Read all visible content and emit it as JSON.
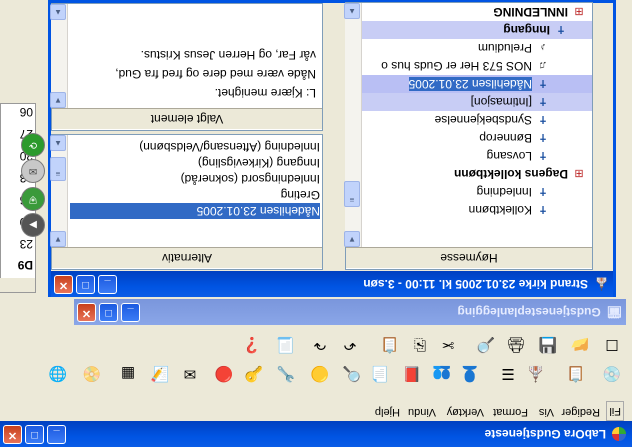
{
  "app": {
    "title": "LabOra Gudstjeneste",
    "menu": [
      "Fil",
      "Rediger",
      "Vis",
      "Format",
      "Verktøy",
      "Vindu",
      "Hjelp"
    ]
  },
  "planner_window": {
    "title": "Gudstjenesteplanlegging"
  },
  "service_window": {
    "title": "Strand kirke 23.01.2005 kl. 11:00 - 3.søn",
    "order_panel": {
      "header": "Høymesse",
      "items": [
        {
          "label": "INNLEDNING",
          "icon": "group-icon",
          "selected": false
        },
        {
          "label": "Inngang",
          "icon": "cross-icon",
          "selected": false
        },
        {
          "label": "Preludium",
          "icon": "music-icon",
          "selected": false
        },
        {
          "label": "NOS 573 Her er Guds hus o",
          "icon": "hymn-icon",
          "selected": false
        },
        {
          "label": "Nådehilsen 23.01.2005",
          "icon": "cross-icon",
          "selected": true
        },
        {
          "label": "[Intimasjon]",
          "icon": "cross-icon",
          "selected": false
        },
        {
          "label": "Syndsbekjennelse",
          "icon": "cross-icon",
          "selected": false
        },
        {
          "label": "Bønnerop",
          "icon": "cross-icon",
          "selected": false
        },
        {
          "label": "Lovsang",
          "icon": "cross-icon",
          "selected": false
        },
        {
          "label": "Dagens kollektbønn",
          "icon": "group-icon",
          "selected": false
        },
        {
          "label": "Innledning",
          "icon": "cross-icon",
          "selected": false
        },
        {
          "label": "Kollektbønn",
          "icon": "cross-icon",
          "selected": false
        }
      ]
    },
    "alternatives_panel": {
      "header": "Alternativ",
      "items": [
        "Innledning (Aftensang/Veldsbønn)",
        "Inngang (Kirkevigsling)",
        "Innledningsord (sokneråd)",
        "Greting",
        "Nådehilsen 23.01.2005"
      ],
      "selected_index": 4
    },
    "selected_panel": {
      "header": "Valgt element",
      "lines": [
        "L: Kjære menighet.",
        "Nåde være med dere og fred fra Gud,",
        "vår Far, og Herren Jesus Kristus."
      ]
    }
  },
  "background_table": {
    "rows": [
      "23",
      "30",
      "06",
      "13",
      "20",
      "27",
      "06"
    ],
    "bold_row": "D9"
  }
}
